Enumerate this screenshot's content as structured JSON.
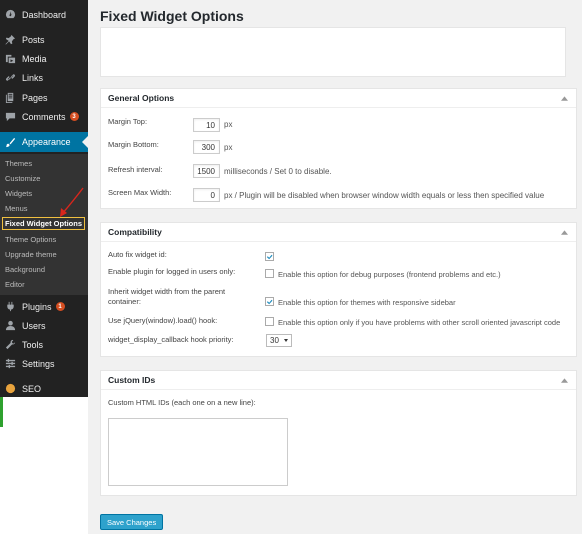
{
  "sidebar": {
    "items": [
      {
        "label": "Dashboard",
        "icon": "dashboard-icon"
      },
      {
        "label": "Posts",
        "icon": "pin-icon"
      },
      {
        "label": "Media",
        "icon": "media-icon"
      },
      {
        "label": "Links",
        "icon": "link-icon"
      },
      {
        "label": "Pages",
        "icon": "pages-icon"
      },
      {
        "label": "Comments",
        "icon": "comment-icon",
        "badge": "3"
      },
      {
        "label": "Appearance",
        "icon": "brush-icon"
      },
      {
        "label": "Plugins",
        "icon": "plug-icon",
        "badge": "1"
      },
      {
        "label": "Users",
        "icon": "user-icon"
      },
      {
        "label": "Tools",
        "icon": "wrench-icon"
      },
      {
        "label": "Settings",
        "icon": "settings-icon"
      },
      {
        "label": "SEO",
        "icon": "seo-icon"
      }
    ],
    "submenu": [
      "Themes",
      "Customize",
      "Widgets",
      "Menus",
      "Fixed Widget Options",
      "Theme Options",
      "Upgrade theme",
      "Background",
      "Editor"
    ]
  },
  "page": {
    "title": "Fixed Widget Options"
  },
  "general": {
    "title": "General Options",
    "margin_top_label": "Margin Top:",
    "margin_top_value": "10",
    "margin_top_unit": "px",
    "margin_bottom_label": "Margin Bottom:",
    "margin_bottom_value": "300",
    "margin_bottom_unit": "px",
    "refresh_label": "Refresh interval:",
    "refresh_value": "1500",
    "refresh_unit": "milliseconds / Set 0 to disable.",
    "screen_label": "Screen Max Width:",
    "screen_value": "0",
    "screen_unit": "px / Plugin will be disabled when browser window width equals or less then specified value"
  },
  "compat": {
    "title": "Compatibility",
    "auto_fix_label": "Auto fix widget id:",
    "logged_label": "Enable plugin for logged in users only:",
    "logged_desc": "Enable this option for debug purposes (frontend problems and etc.)",
    "inherit_label_1": "Inherit widget width from the parent",
    "inherit_label_2": "container:",
    "inherit_desc": "Enable this option for themes with responsive sidebar",
    "jquery_label": "Use jQuery(window).load() hook:",
    "jquery_desc": "Enable this option only if you have problems with other scroll oriented javascript code",
    "callback_label": "widget_display_callback hook priority:",
    "callback_value": "30"
  },
  "custom": {
    "title": "Custom IDs",
    "ids_label": "Custom HTML IDs (each one on a new line):"
  },
  "save_label": "Save Changes",
  "colors": {
    "admin_blue": "#0074a2",
    "sidebar_dark": "#222222",
    "button_blue": "#2ea2cc",
    "annotation_red": "#d9261c"
  }
}
